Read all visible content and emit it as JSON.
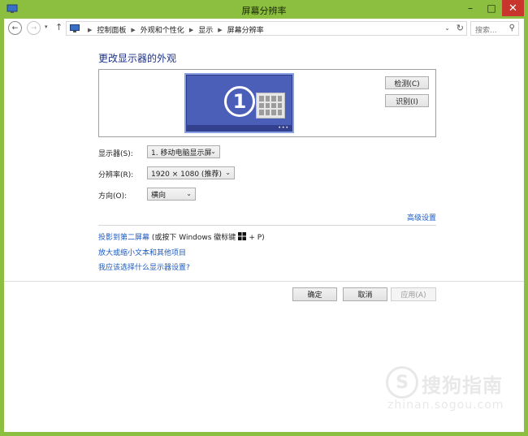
{
  "window": {
    "title": "屏幕分辨率",
    "controls": {
      "minimize": "–",
      "maximize": "□",
      "close": "✕"
    }
  },
  "address_bar": {
    "back_icon": "←",
    "forward_icon": "→",
    "history_dropdown_icon": "▾",
    "up_icon": "↑",
    "breadcrumbs": [
      "控制面板",
      "外观和个性化",
      "显示",
      "屏幕分辨率"
    ],
    "breadcrumb_separator": "▶",
    "dropdown_icon": "⌄",
    "refresh_icon": "↻",
    "search_placeholder": "搜索...",
    "search_icon": "⚲"
  },
  "main": {
    "heading": "更改显示器的外观",
    "preview": {
      "monitor_number": "1",
      "monitor_dots": "•••",
      "detect_label": "检测(C)",
      "identify_label": "识别(I)"
    },
    "fields": {
      "display_label": "显示器(S):",
      "display_value": "1. 移动电脑显示屏",
      "resolution_label": "分辨率(R):",
      "resolution_value": "1920 × 1080 (推荐)",
      "orientation_label": "方向(O):",
      "orientation_value": "横向",
      "dropdown_icon": "⌄"
    },
    "advanced_link": "高级设置",
    "links": {
      "project_link": "投影到第二屏幕",
      "project_hint_prefix": "(或按下 Windows 徽标键",
      "project_hint_suffix": "+ P)",
      "text_size_link": "放大或缩小文本和其他项目",
      "which_settings_link": "我应该选择什么显示器设置?"
    },
    "buttons": {
      "ok": "确定",
      "cancel": "取消",
      "apply": "应用(A)"
    }
  },
  "watermark": {
    "brand": "搜狗指南",
    "url": "zhinan.sogou.com",
    "logo_glyph": "S"
  },
  "colors": {
    "frame": "#8cbf40",
    "close_button": "#c7352d",
    "heading": "#1e3287",
    "link": "#1c5bc0",
    "monitor": "#4b5eb8"
  }
}
